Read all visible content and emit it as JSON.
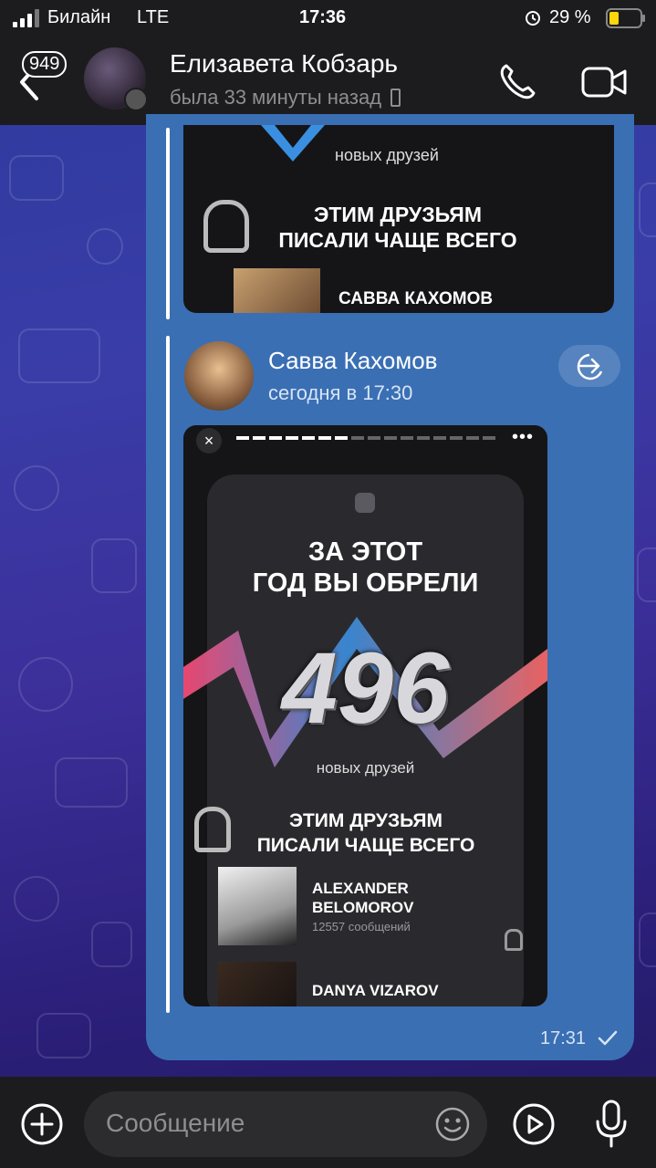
{
  "status": {
    "carrier": "Билайн",
    "network": "LTE",
    "time": "17:36",
    "battery": "29 %"
  },
  "header": {
    "back_count": "949",
    "name": "Елизавета Кобзарь",
    "status": "была 33 минуты назад"
  },
  "top_preview": {
    "caption": "новых друзей",
    "heading_line1": "ЭТИМ ДРУЗЬЯМ",
    "heading_line2": "ПИСАЛИ ЧАЩЕ ВСЕГО",
    "friend_name": "САВВА КАХОМОВ"
  },
  "forward": {
    "name": "Савва Кахомов",
    "date": "сегодня в 17:30"
  },
  "story": {
    "title_line1": "ЗА ЭТОТ",
    "title_line2": "ГОД ВЫ ОБРЕЛИ",
    "count": "496",
    "caption": "новых друзей",
    "heading_line1": "ЭТИМ ДРУЗЬЯМ",
    "heading_line2": "ПИСАЛИ ЧАЩЕ ВСЕГО",
    "friend1_line1": "ALEXANDER",
    "friend1_line2": "BELOMOROV",
    "friend1_messages": "12557 сообщений",
    "friend2_name": "DANYA VIZAROV"
  },
  "message": {
    "time": "17:31"
  },
  "composer": {
    "placeholder": "Сообщение"
  },
  "colors": {
    "bubble": "#3a6fb4",
    "bar": "#1c1c1e",
    "accent": "#5aa0ff"
  },
  "icons": [
    "signal-icon",
    "alarm-icon",
    "battery-icon",
    "back-icon",
    "phone-icon",
    "video-icon",
    "forward-icon",
    "check-icon",
    "attach-icon",
    "emoji-icon",
    "video-message-icon",
    "mic-icon"
  ]
}
